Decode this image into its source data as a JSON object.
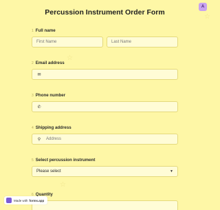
{
  "form": {
    "title": "Percussion Instrument Order Form"
  },
  "badge": {
    "label": "A"
  },
  "fields": {
    "full_name": {
      "number": "1",
      "label": "Full name",
      "first_placeholder": "First Name",
      "last_placeholder": "Last Name"
    },
    "email": {
      "number": "2",
      "label": "Email address",
      "icon": "mail-icon",
      "value": ""
    },
    "phone": {
      "number": "3",
      "label": "Phone number",
      "icon": "phone-icon",
      "value": ""
    },
    "shipping": {
      "number": "4",
      "label": "Shipping address",
      "icon": "location-pin-icon",
      "placeholder": "Address"
    },
    "instrument": {
      "number": "5",
      "label": "Select percussion instrument",
      "selected": "Please select"
    },
    "quantity": {
      "number": "6",
      "label": "Quantity",
      "value": ""
    }
  },
  "footer": {
    "made_with": "Made with",
    "brand": "forms.app"
  }
}
